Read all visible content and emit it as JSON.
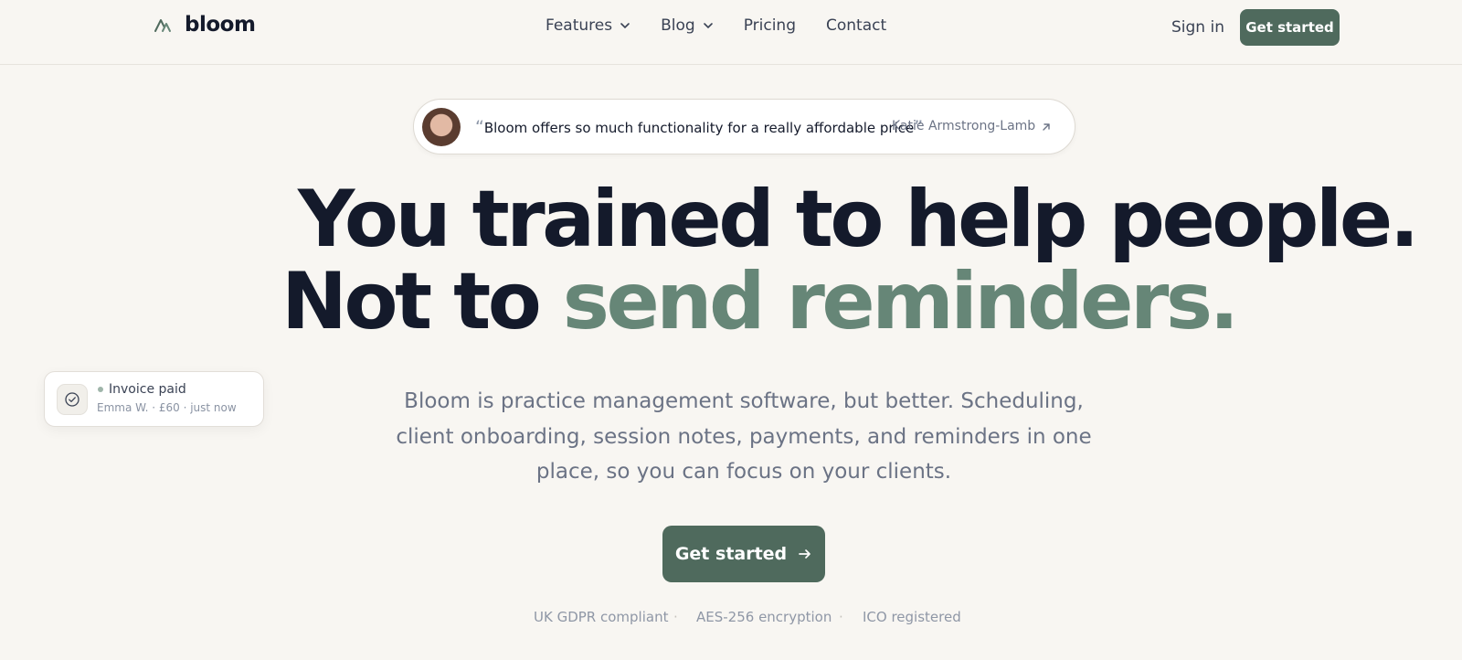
{
  "header": {
    "brand": "bloom",
    "nav": [
      {
        "label": "Features",
        "has_dropdown": true
      },
      {
        "label": "Blog",
        "has_dropdown": true
      },
      {
        "label": "Pricing",
        "has_dropdown": false
      },
      {
        "label": "Contact",
        "has_dropdown": false
      }
    ],
    "sign_in": "Sign in",
    "get_started": "Get started"
  },
  "testimonial": {
    "quote": "Bloom offers so much functionality for a really affordable price",
    "open_quote": "“",
    "close_quote": "”",
    "author": "Katie Armstrong-Lamb"
  },
  "hero": {
    "line1": "You trained to help people.",
    "line2_prefix": "Not to",
    "line2_accent": "send reminders.",
    "description": "Bloom is practice management software, but better. Scheduling, client onboarding, session notes, payments, and reminders in one place, so you can focus on your clients.",
    "cta": "Get started"
  },
  "notification": {
    "title": "Invoice paid",
    "subtitle": "Emma W. · £60 · just now"
  },
  "trust": [
    "UK GDPR compliant",
    "AES-256 encryption",
    "ICO registered"
  ],
  "colors": {
    "brand_green": "#4f6a5d",
    "accent_green": "#668677",
    "background": "#f8f6f2",
    "heading": "#141a2b"
  }
}
